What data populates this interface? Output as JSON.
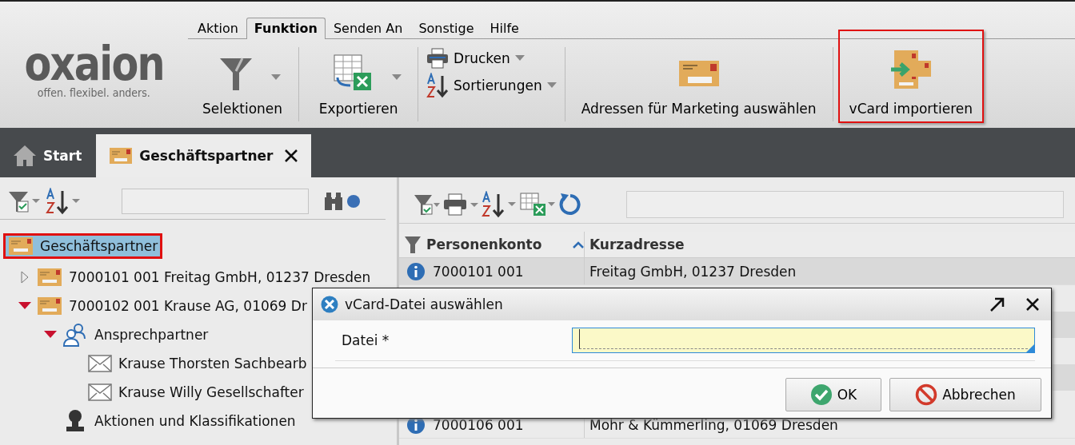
{
  "logo": {
    "name": "oxaion",
    "tagline": "offen. flexibel. anders."
  },
  "menu": [
    {
      "label": "Aktion",
      "selected": false
    },
    {
      "label": "Funktion",
      "selected": true
    },
    {
      "label": "Senden An",
      "selected": false
    },
    {
      "label": "Sonstige",
      "selected": false
    },
    {
      "label": "Hilfe",
      "selected": false
    }
  ],
  "ribbon": {
    "items": [
      {
        "kind": "large",
        "label": "Selektionen",
        "dropdown": true,
        "highlighted": false
      },
      {
        "kind": "large",
        "label": "Exportieren",
        "dropdown": true,
        "highlighted": false
      },
      {
        "kind": "stack",
        "entries": [
          {
            "label": "Drucken",
            "dropdown": true
          },
          {
            "label": "Sortierungen",
            "dropdown": true
          }
        ]
      },
      {
        "kind": "large",
        "label": "Adressen für Marketing auswählen",
        "dropdown": false,
        "highlighted": false
      },
      {
        "kind": "large",
        "label": "vCard importieren",
        "dropdown": false,
        "highlighted": true
      }
    ]
  },
  "tabs": [
    {
      "label": "Start",
      "selected": false,
      "closable": false
    },
    {
      "label": "Geschäftspartner",
      "selected": true,
      "closable": true
    }
  ],
  "tree": [
    {
      "kind": "partner",
      "label": "Geschäftspartner",
      "selected": true,
      "highlighted": true,
      "children": [
        {
          "kind": "partner",
          "label": "7000101 001 Freitag GmbH, 01237 Dresden",
          "selected": false,
          "highlighted": false,
          "expanded": false
        },
        {
          "kind": "partner",
          "label": "7000102 001 Krause AG, 01069 Dr",
          "selected": false,
          "highlighted": false,
          "expanded": true,
          "children": [
            {
              "kind": "contacts",
              "label": "Ansprechpartner",
              "selected": false,
              "highlighted": false,
              "expanded": true,
              "children": [
                {
                  "kind": "contact",
                  "label": "Krause Thorsten Sachbearb",
                  "selected": false,
                  "highlighted": false
                },
                {
                  "kind": "contact",
                  "label": "Krause Willy Gesellschafter",
                  "selected": false,
                  "highlighted": false
                }
              ]
            },
            {
              "kind": "actions",
              "label": "Aktionen und Klassifikationen",
              "selected": false,
              "highlighted": false
            }
          ]
        }
      ]
    }
  ],
  "table": {
    "columns": [
      "Personenkonto",
      "Kurzadresse"
    ],
    "rows": [
      {
        "selected": true,
        "cells": [
          "7000101 001",
          "Freitag GmbH, 01237 Dresden"
        ]
      },
      {
        "selected": false,
        "cells": [
          "7000106 001",
          "Mohr & Kümmerling, 01069 Dresden"
        ]
      }
    ]
  },
  "dialog": {
    "title": "vCard-Datei auswählen",
    "field_label": "Datei *",
    "buttons": [
      {
        "kind": "ok",
        "label": "OK"
      },
      {
        "kind": "cancel",
        "label": "Abbrechen"
      }
    ]
  }
}
